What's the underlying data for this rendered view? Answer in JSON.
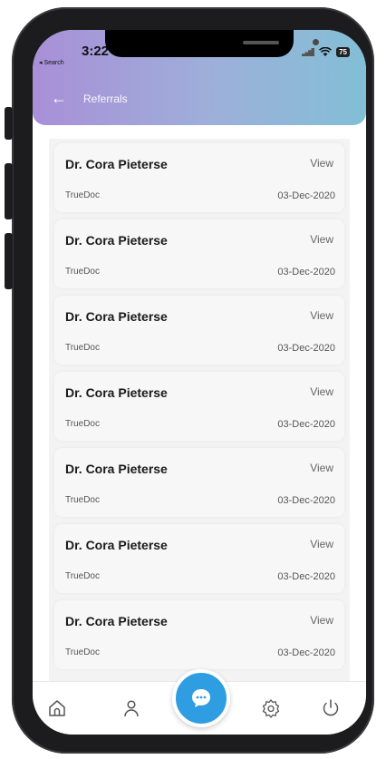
{
  "status_bar": {
    "time": "3:22",
    "back_app": "◂ Search",
    "battery": "75"
  },
  "header": {
    "title": "Referrals"
  },
  "referrals": [
    {
      "name": "Dr. Cora Pieterse",
      "action": "View",
      "org": "TrueDoc",
      "date": "03-Dec-2020"
    },
    {
      "name": "Dr. Cora Pieterse",
      "action": "View",
      "org": "TrueDoc",
      "date": "03-Dec-2020"
    },
    {
      "name": "Dr. Cora Pieterse",
      "action": "View",
      "org": "TrueDoc",
      "date": "03-Dec-2020"
    },
    {
      "name": "Dr. Cora Pieterse",
      "action": "View",
      "org": "TrueDoc",
      "date": "03-Dec-2020"
    },
    {
      "name": "Dr. Cora Pieterse",
      "action": "View",
      "org": "TrueDoc",
      "date": "03-Dec-2020"
    },
    {
      "name": "Dr. Cora Pieterse",
      "action": "View",
      "org": "TrueDoc",
      "date": "03-Dec-2020"
    },
    {
      "name": "Dr. Cora Pieterse",
      "action": "View",
      "org": "TrueDoc",
      "date": "03-Dec-2020"
    }
  ],
  "tab_bar": {
    "icons": [
      "home-icon",
      "profile-icon",
      "chat-icon",
      "settings-icon",
      "power-icon"
    ]
  },
  "colors": {
    "header_gradient_start": "#a98fd8",
    "header_gradient_end": "#82bfd6",
    "fab": "#2e9de2"
  }
}
